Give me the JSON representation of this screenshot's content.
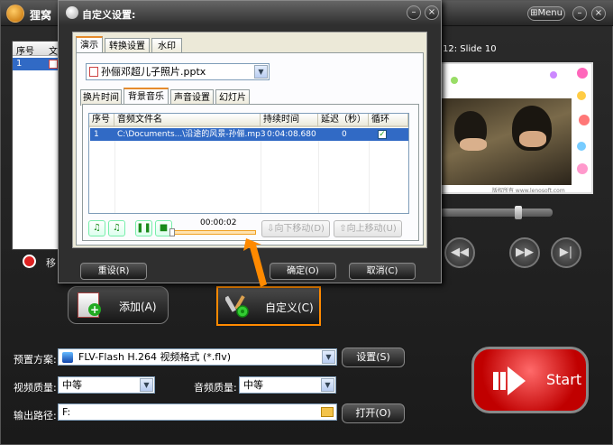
{
  "main": {
    "title": "狸窝",
    "menu_label": "Menu",
    "min_glyph": "–",
    "close_glyph": "×"
  },
  "list": {
    "col_index": "序号",
    "col_file": "文",
    "row1_index": "1",
    "remove_label": "移"
  },
  "preview": {
    "slide_label": "12: Slide 10",
    "caption": "版权所有 www.lenosoft.com"
  },
  "toolbar": {
    "add_label": "添加(A)",
    "custom_label": "自定义(C)"
  },
  "settings": {
    "preset_label": "预置方案:",
    "preset_value": "FLV-Flash H.264 视频格式 (*.flv)",
    "settings_button": "设置(S)",
    "video_quality_label": "视频质量:",
    "video_quality_value": "中等",
    "audio_quality_label": "音频质量:",
    "audio_quality_value": "中等",
    "output_label": "输出路径:",
    "output_value": "F:",
    "open_button": "打开(O)",
    "start_label": "Start"
  },
  "dialog": {
    "title": "自定义设置:",
    "tabs": [
      "演示",
      "转换设置",
      "水印"
    ],
    "file_select": "孙俪邓超儿子照片.pptx",
    "subtabs": [
      "换片时间",
      "背景音乐",
      "声音设置",
      "幻灯片"
    ],
    "table": {
      "headers": [
        "序号",
        "音频文件名",
        "持续时间",
        "延迟（秒）",
        "循环"
      ],
      "rows": [
        {
          "index": "1",
          "file": "C:\\Documents...\\沿途的风景-孙俪.mp3",
          "duration": "0:04:08.680",
          "delay": "0",
          "loop": true
        }
      ]
    },
    "time_display": "00:00:02",
    "playback_progress": 0.0,
    "move_down_button": "向下移动(D)",
    "move_up_button": "向上移动(U)",
    "reset_button": "重设(R)",
    "ok_button": "确定(O)",
    "cancel_button": "取消(C)"
  },
  "colors": {
    "accent_orange": "#ff8a00",
    "selection_blue": "#316ac5",
    "start_red": "#c00000"
  }
}
